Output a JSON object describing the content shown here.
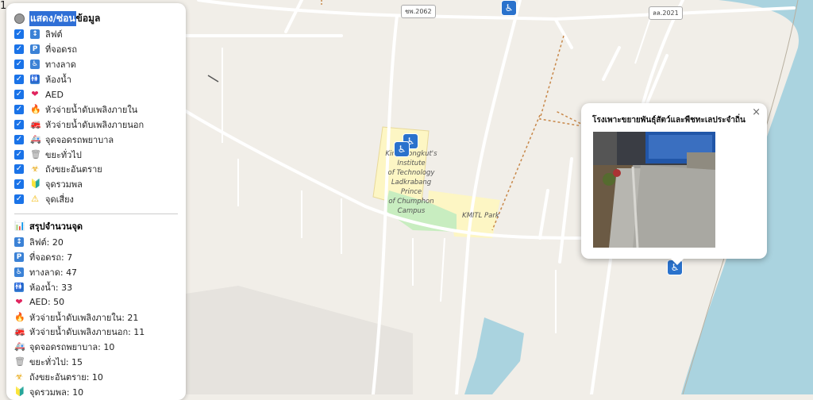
{
  "panel": {
    "title_hl": "แสดง/ซ่อน",
    "title_rest": "ข้อมูล",
    "layers": [
      {
        "label": "ลิฟต์",
        "icon": "elevator-icon",
        "glyph": "↕",
        "color": "#3b82d6"
      },
      {
        "label": "ที่จอดรถ",
        "icon": "parking-icon",
        "glyph": "P",
        "color": "#3b82d6"
      },
      {
        "label": "ทางลาด",
        "icon": "wheelchair-icon",
        "glyph": "♿",
        "color": "#3b82d6"
      },
      {
        "label": "ห้องน้ำ",
        "icon": "restroom-icon",
        "glyph": "🚻",
        "color": "#3b82d6"
      },
      {
        "label": "AED",
        "icon": "heart-icon",
        "glyph": "❤",
        "color": "#e0245e"
      },
      {
        "label": "หัวจ่ายน้ำดับเพลิงภายใน",
        "icon": "fire-icon",
        "glyph": "🔥",
        "color": "#f5821f"
      },
      {
        "label": "หัวจ่ายน้ำดับเพลิงภายนอก",
        "icon": "fire-truck-icon",
        "glyph": "🚒",
        "color": "#d22"
      },
      {
        "label": "จุดจอดรถพยาบาล",
        "icon": "ambulance-icon",
        "glyph": "🚑",
        "color": "#d22"
      },
      {
        "label": "ขยะทั่วไป",
        "icon": "trash-icon",
        "glyph": "🗑",
        "color": "#888"
      },
      {
        "label": "ถังขยะอันตราย",
        "icon": "biohazard-icon",
        "glyph": "☣",
        "color": "#e6a100"
      },
      {
        "label": "จุดรวมพล",
        "icon": "flag-icon",
        "glyph": "🔰",
        "color": "#2e9e46"
      },
      {
        "label": "จุดเสี่ยง",
        "icon": "warning-icon",
        "glyph": "⚠",
        "color": "#f2b705"
      }
    ],
    "summary_title": "สรุปจำนวนจุด",
    "summary": [
      {
        "text": "ลิฟต์: 20",
        "icon": "elevator-icon",
        "glyph": "↕",
        "color": "#3b82d6"
      },
      {
        "text": "ที่จอดรถ: 7",
        "icon": "parking-icon",
        "glyph": "P",
        "color": "#3b82d6"
      },
      {
        "text": "ทางลาด: 47",
        "icon": "wheelchair-icon",
        "glyph": "♿",
        "color": "#3b82d6"
      },
      {
        "text": "ห้องน้ำ: 33",
        "icon": "restroom-icon",
        "glyph": "🚻",
        "color": "#3b82d6"
      },
      {
        "text": "AED: 50",
        "icon": "heart-icon",
        "glyph": "❤",
        "color": "#e0245e"
      },
      {
        "text": "หัวจ่ายน้ำดับเพลิงภายใน: 21",
        "icon": "fire-icon",
        "glyph": "🔥",
        "color": "#f5821f"
      },
      {
        "text": "หัวจ่ายน้ำดับเพลิงภายนอก: 11",
        "icon": "fire-truck-icon",
        "glyph": "🚒",
        "color": "#d22"
      },
      {
        "text": "จุดจอดรถพยาบาล: 10",
        "icon": "ambulance-icon",
        "glyph": "🚑",
        "color": "#d22"
      },
      {
        "text": "ขยะทั่วไป: 15",
        "icon": "trash-icon",
        "glyph": "🗑",
        "color": "#888"
      },
      {
        "text": "ถังขยะอันตราย: 10",
        "icon": "biohazard-icon",
        "glyph": "☣",
        "color": "#e6a100"
      },
      {
        "text": "จุดรวมพล: 10",
        "icon": "flag-icon",
        "glyph": "🔰",
        "color": "#2e9e46"
      }
    ]
  },
  "popup": {
    "title": "โรงเพาะขยายพันธุ์สัตว์และพืชทะเลประจำถิ่น",
    "close": "×"
  },
  "map": {
    "corner_text": "1",
    "road_labels": [
      "ชพ.2062",
      "ลล.2021"
    ],
    "campus_label": [
      "King Mongkut's",
      "Institute",
      "of Technology",
      "Ladkrabang",
      "Prince",
      "of Chumphon",
      "Campus"
    ],
    "park_label": "KMITL Park",
    "colors": {
      "land": "#f1eee8",
      "sea": "#aad3df",
      "campus": "#fdf6c4",
      "park": "#c8edc0",
      "marker": "#2a72cc"
    }
  }
}
